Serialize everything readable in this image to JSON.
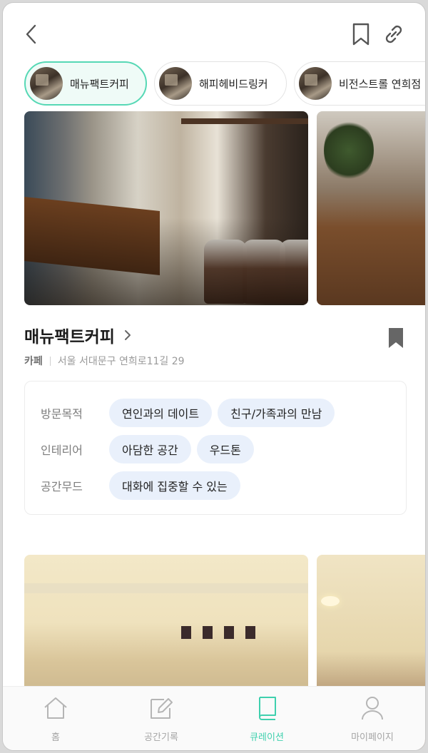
{
  "header": {
    "back_icon": "chevron-left-icon",
    "bookmark_icon": "bookmark-outline-icon",
    "link_icon": "link-icon"
  },
  "chips": [
    {
      "label": "매뉴팩트커피",
      "active": true
    },
    {
      "label": "해피헤비드링커",
      "active": false
    },
    {
      "label": "비전스트롤 연희점",
      "active": false
    }
  ],
  "place": {
    "name": "매뉴팩트커피",
    "category": "카페",
    "address": "서울 서대문구 연희로11길 29"
  },
  "tags": {
    "purpose": {
      "label": "방문목적",
      "values": [
        "연인과의 데이트",
        "친구/가족과의 만남"
      ]
    },
    "interior": {
      "label": "인테리어",
      "values": [
        "아담한 공간",
        "우드톤"
      ]
    },
    "mood": {
      "label": "공간무드",
      "values": [
        "대화에 집중할 수 있는"
      ]
    }
  },
  "tabbar": [
    {
      "label": "홈",
      "icon": "home-icon",
      "active": false
    },
    {
      "label": "공간기록",
      "icon": "edit-note-icon",
      "active": false
    },
    {
      "label": "큐레이션",
      "icon": "book-icon",
      "active": true
    },
    {
      "label": "마이페이지",
      "icon": "person-icon",
      "active": false
    }
  ],
  "colors": {
    "accent": "#56d8b5",
    "tag_bg": "#e9f0fb"
  }
}
